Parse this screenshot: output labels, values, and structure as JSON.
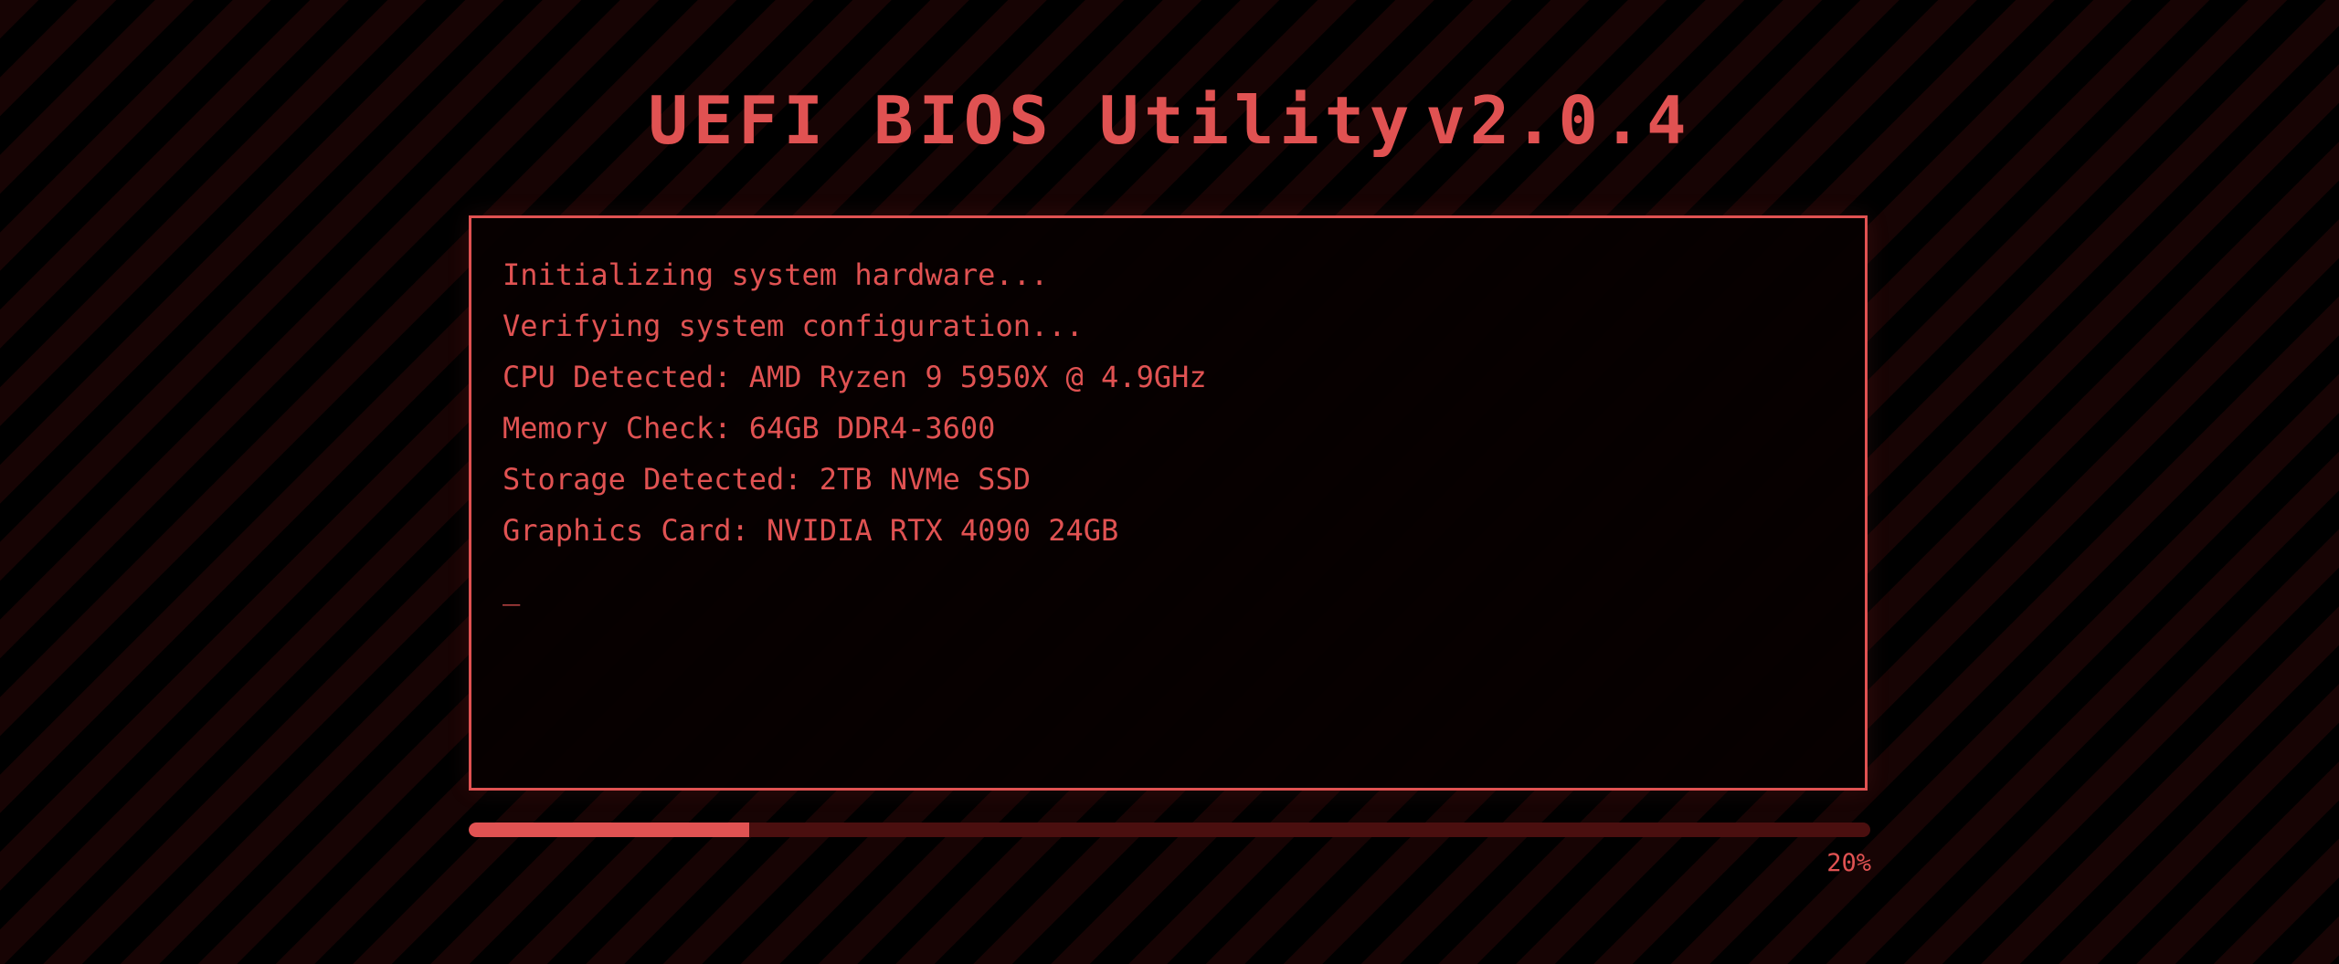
{
  "title": {
    "main": "UEFI BIOS Utility",
    "version": "v2.0.4"
  },
  "console": {
    "lines": [
      "Initializing system hardware...",
      "Verifying system configuration...",
      "CPU Detected: AMD Ryzen 9 5950X @ 4.9GHz",
      "Memory Check: 64GB DDR4-3600",
      "Storage Detected: 2TB NVMe SSD",
      "Graphics Card: NVIDIA RTX 4090 24GB"
    ],
    "cursor": "_"
  },
  "progress": {
    "value": 0.2,
    "label": "20%"
  },
  "colors": {
    "accent": "#e05252",
    "track": "#4a0f0f",
    "background": "#000000",
    "stripe": "#170404"
  }
}
